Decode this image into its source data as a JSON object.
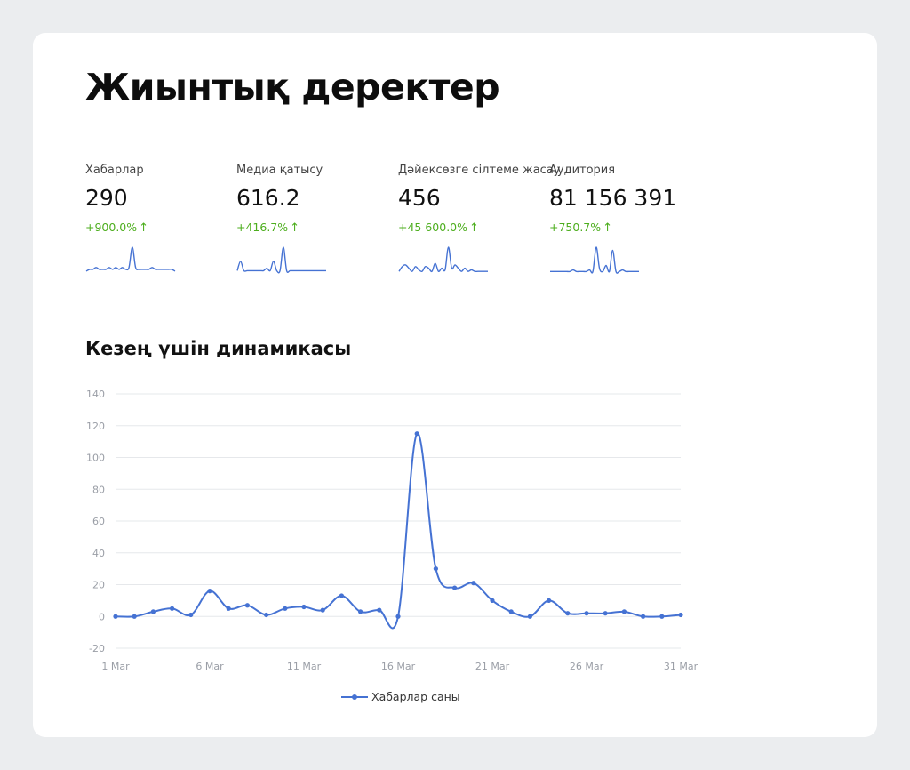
{
  "page": {
    "title": "Жиынтық деректер"
  },
  "metrics": [
    {
      "label": "Хабарлар",
      "value": "290",
      "change": "+900.0%",
      "spark": [
        1,
        2,
        2,
        3,
        2,
        2,
        2,
        3,
        2,
        3,
        2,
        3,
        2,
        3,
        14,
        3,
        2,
        2,
        2,
        2,
        3,
        2,
        2,
        2,
        2,
        2,
        2,
        1
      ]
    },
    {
      "label": "Медиа қатысу",
      "value": "616.2",
      "change": "+416.7%",
      "spark": [
        1,
        5,
        1,
        1,
        1,
        1,
        1,
        1,
        1,
        2,
        1,
        5,
        1,
        1,
        11,
        1,
        1,
        1,
        1,
        1,
        1,
        1,
        1,
        1,
        1,
        1,
        1,
        1
      ]
    },
    {
      "label": "Дәйексөзге сілтеме жасау",
      "value": "456",
      "change": "+45 600.0%",
      "spark": [
        1,
        4,
        5,
        3,
        1,
        4,
        2,
        1,
        4,
        3,
        1,
        6,
        1,
        3,
        2,
        16,
        3,
        5,
        3,
        1,
        3,
        1,
        2,
        1,
        1,
        1,
        1,
        1
      ]
    },
    {
      "label": "Аудитория",
      "value": "81 156 391",
      "change": "+750.7%",
      "spark": [
        1,
        1,
        1,
        1,
        1,
        1,
        1,
        2,
        1,
        1,
        1,
        1,
        2,
        1,
        17,
        3,
        1,
        5,
        1,
        15,
        1,
        1,
        2,
        1,
        1,
        1,
        1,
        1
      ]
    }
  ],
  "section": {
    "title": "Кезең үшін динамикасы"
  },
  "chart_data": {
    "type": "line",
    "x": [
      "1 Mar",
      "2 Mar",
      "3 Mar",
      "4 Mar",
      "5 Mar",
      "6 Mar",
      "7 Mar",
      "8 Mar",
      "9 Mar",
      "10 Mar",
      "11 Mar",
      "12 Mar",
      "13 Mar",
      "14 Mar",
      "15 Mar",
      "16 Mar",
      "17 Mar",
      "18 Mar",
      "19 Mar",
      "20 Mar",
      "21 Mar",
      "22 Mar",
      "23 Mar",
      "24 Mar",
      "25 Mar",
      "26 Mar",
      "27 Mar",
      "28 Mar",
      "29 Mar",
      "30 Mar",
      "31 Mar"
    ],
    "xticks": [
      "1 Маr",
      "6 Маr",
      "11 Маr",
      "16 Маr",
      "21 Маr",
      "26 Маr",
      "31 Маr"
    ],
    "series": [
      {
        "name": "Хабарлар саны",
        "color": "#4572d3",
        "values": [
          0,
          0,
          3,
          5,
          1,
          16,
          5,
          7,
          1,
          5,
          6,
          4,
          13,
          3,
          4,
          0,
          115,
          30,
          18,
          21,
          10,
          3,
          0,
          10,
          2,
          2,
          2,
          3,
          0,
          0,
          1
        ]
      }
    ],
    "ylim": [
      -20,
      140
    ],
    "yticks": [
      -20,
      0,
      20,
      40,
      60,
      80,
      100,
      120,
      140
    ],
    "grid": true,
    "legend": "bottom"
  },
  "colors": {
    "accent": "#4572d3",
    "positive": "#4dae1e",
    "background": "#ebedef"
  }
}
